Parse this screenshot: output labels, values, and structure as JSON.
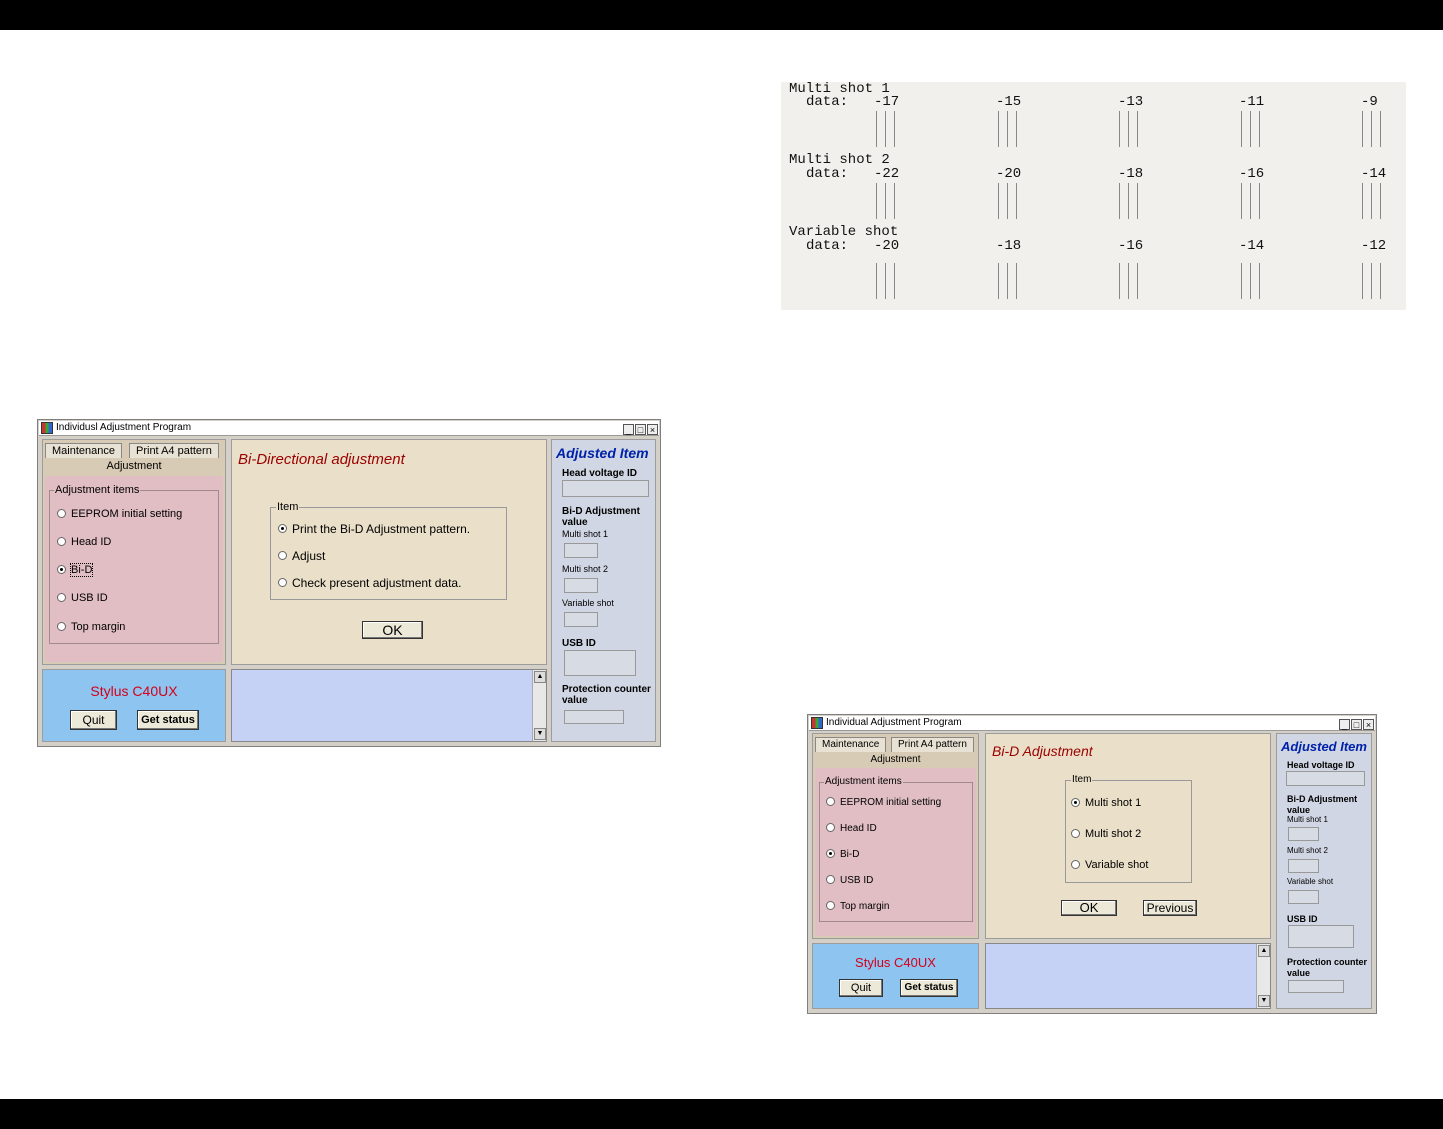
{
  "pattern": {
    "rows": [
      {
        "title": "Multi shot 1",
        "label": "data:",
        "values": [
          "-17",
          "-15",
          "-13",
          "-11",
          "-9"
        ]
      },
      {
        "title": "Multi shot 2",
        "label": "data:",
        "values": [
          "-22",
          "-20",
          "-18",
          "-16",
          "-14"
        ]
      },
      {
        "title": "Variable shot",
        "label": "data:",
        "values": [
          "-20",
          "-18",
          "-16",
          "-14",
          "-12"
        ]
      }
    ]
  },
  "window1": {
    "title": "Individusl Adjustment Program",
    "tabs": [
      "Maintenance",
      "Print A4 pattern"
    ],
    "active_tab": "Adjustment",
    "group_label": "Adjustment items",
    "items": [
      "EEPROM initial setting",
      "Head ID",
      "Bi-D",
      "USB ID",
      "Top margin"
    ],
    "selected_item": "Bi-D",
    "model": "Stylus C40UX",
    "quit": "Quit",
    "get_status": "Get status",
    "center_title": "Bi-Directional adjustment",
    "center_group": "Item",
    "options": [
      "Print the Bi-D Adjustment pattern.",
      "Adjust",
      "Check present adjustment data."
    ],
    "selected_option": "Print the Bi-D Adjustment pattern.",
    "ok": "OK",
    "right": {
      "title": "Adjusted Item",
      "head_voltage": "Head voltage ID",
      "bid": "Bi-D Adjustment value",
      "ms1": "Multi shot 1",
      "ms2": "Multi shot 2",
      "vs": "Variable shot",
      "usb": "USB ID",
      "prot": "Protection counter value"
    }
  },
  "window2": {
    "title": "Individual Adjustment Program",
    "tabs": [
      "Maintenance",
      "Print A4 pattern"
    ],
    "active_tab": "Adjustment",
    "group_label": "Adjustment items",
    "items": [
      "EEPROM initial setting",
      "Head ID",
      "Bi-D",
      "USB ID",
      "Top margin"
    ],
    "selected_item": "Bi-D",
    "model": "Stylus C40UX",
    "quit": "Quit",
    "get_status": "Get status",
    "center_title": "Bi-D Adjustment",
    "center_group": "Item",
    "options": [
      "Multi shot 1",
      "Multi shot 2",
      "Variable shot"
    ],
    "selected_option": "Multi shot 1",
    "ok": "OK",
    "previous": "Previous",
    "right": {
      "title": "Adjusted Item",
      "head_voltage": "Head voltage ID",
      "bid": "Bi-D Adjustment value",
      "ms1": "Multi shot 1",
      "ms2": "Multi shot 2",
      "vs": "Variable shot",
      "usb": "USB ID",
      "prot": "Protection counter value"
    }
  }
}
